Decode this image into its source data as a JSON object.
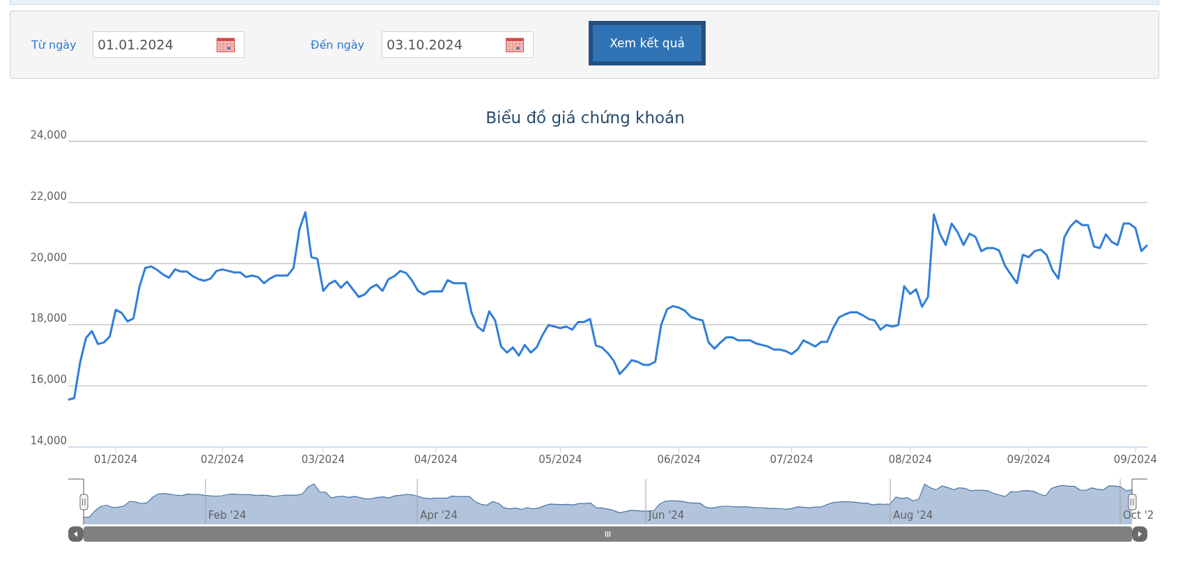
{
  "filter": {
    "from_label": "Từ ngày",
    "from_value": "01.01.2024",
    "to_label": "Đến ngày",
    "to_value": "03.10.2024",
    "submit": "Xem kết quả"
  },
  "chart": {
    "chart_data": {
      "type": "line",
      "title": "Biểu đồ giá chứng khoán",
      "ylim": [
        14000,
        24000
      ],
      "grid": true,
      "categories": [
        null,
        null,
        null,
        null,
        null,
        null,
        null,
        null,
        "01/2024",
        null,
        null,
        null,
        null,
        null,
        null,
        null,
        null,
        null,
        null,
        null,
        null,
        null,
        null,
        null,
        null,
        null,
        "02/2024",
        null,
        null,
        null,
        null,
        null,
        null,
        null,
        null,
        null,
        null,
        null,
        null,
        null,
        null,
        null,
        null,
        "03/2024",
        null,
        null,
        null,
        null,
        null,
        null,
        null,
        null,
        null,
        null,
        null,
        null,
        null,
        null,
        null,
        null,
        null,
        null,
        "04/2024",
        null,
        null,
        null,
        null,
        null,
        null,
        null,
        null,
        null,
        null,
        null,
        null,
        null,
        null,
        null,
        null,
        null,
        null,
        null,
        null,
        "05/2024",
        null,
        null,
        null,
        null,
        null,
        null,
        null,
        null,
        null,
        null,
        null,
        null,
        null,
        null,
        null,
        null,
        null,
        null,
        null,
        "06/2024",
        null,
        null,
        null,
        null,
        null,
        null,
        null,
        null,
        null,
        null,
        null,
        null,
        null,
        null,
        null,
        null,
        null,
        null,
        "07/2024",
        null,
        null,
        null,
        null,
        null,
        null,
        null,
        null,
        null,
        null,
        null,
        null,
        null,
        null,
        null,
        null,
        null,
        null,
        null,
        "08/2024",
        null,
        null,
        null,
        null,
        null,
        null,
        null,
        null,
        null,
        null,
        null,
        null,
        null,
        null,
        null,
        null,
        null,
        null,
        null,
        "09/2024",
        null,
        null,
        null,
        null,
        null,
        null,
        null,
        null,
        null,
        null,
        null,
        null,
        null,
        null,
        null,
        null,
        null,
        "09/2024",
        null,
        null
      ],
      "yticks": [
        {
          "value": 14000,
          "label": "14,000"
        },
        {
          "value": 16000,
          "label": "16,000"
        },
        {
          "value": 18000,
          "label": "18,000"
        },
        {
          "value": 20000,
          "label": "20,000"
        },
        {
          "value": 22000,
          "label": "22,000"
        },
        {
          "value": 24000,
          "label": "24,000"
        }
      ],
      "series": [
        {
          "color": "#2f7ed8",
          "values": [
            15550,
            15600,
            16770,
            17570,
            17790,
            17370,
            17420,
            17620,
            18490,
            18390,
            18110,
            18210,
            19240,
            19860,
            19910,
            19790,
            19640,
            19540,
            19810,
            19740,
            19740,
            19590,
            19490,
            19440,
            19510,
            19760,
            19810,
            19760,
            19710,
            19710,
            19560,
            19610,
            19560,
            19360,
            19510,
            19610,
            19610,
            19610,
            19860,
            21130,
            21680,
            20210,
            20160,
            19110,
            19340,
            19440,
            19210,
            19410,
            19160,
            18910,
            18990,
            19210,
            19310,
            19110,
            19490,
            19590,
            19760,
            19690,
            19440,
            19110,
            18990,
            19090,
            19090,
            19090,
            19460,
            19360,
            19360,
            19360,
            18410,
            17940,
            17790,
            18440,
            18140,
            17290,
            17090,
            17260,
            16990,
            17340,
            17090,
            17260,
            17670,
            17990,
            17940,
            17890,
            17940,
            17840,
            18090,
            18090,
            18190,
            17320,
            17260,
            17070,
            16820,
            16390,
            16590,
            16840,
            16790,
            16690,
            16690,
            16790,
            17990,
            18510,
            18610,
            18560,
            18460,
            18260,
            18190,
            18140,
            17420,
            17220,
            17420,
            17590,
            17590,
            17490,
            17490,
            17490,
            17390,
            17340,
            17290,
            17190,
            17190,
            17140,
            17040,
            17190,
            17490,
            17390,
            17290,
            17440,
            17440,
            17890,
            18240,
            18340,
            18410,
            18410,
            18310,
            18190,
            18140,
            17840,
            17990,
            17940,
            17990,
            19260,
            19010,
            19160,
            18590,
            18910,
            21610,
            20980,
            20610,
            21310,
            21030,
            20610,
            20980,
            20880,
            20410,
            20510,
            20510,
            20430,
            19930,
            19640,
            19360,
            20290,
            20210,
            20410,
            20460,
            20290,
            19790,
            19510,
            20860,
            21210,
            21410,
            21260,
            21260,
            20560,
            20510,
            20960,
            20710,
            20610,
            21310,
            21310,
            21160,
            20410,
            20610
          ]
        }
      ]
    },
    "navigator": {
      "labels": [
        "Feb '24",
        "Apr '24",
        "Jun '24",
        "Aug '24",
        "Oct '2"
      ]
    }
  }
}
